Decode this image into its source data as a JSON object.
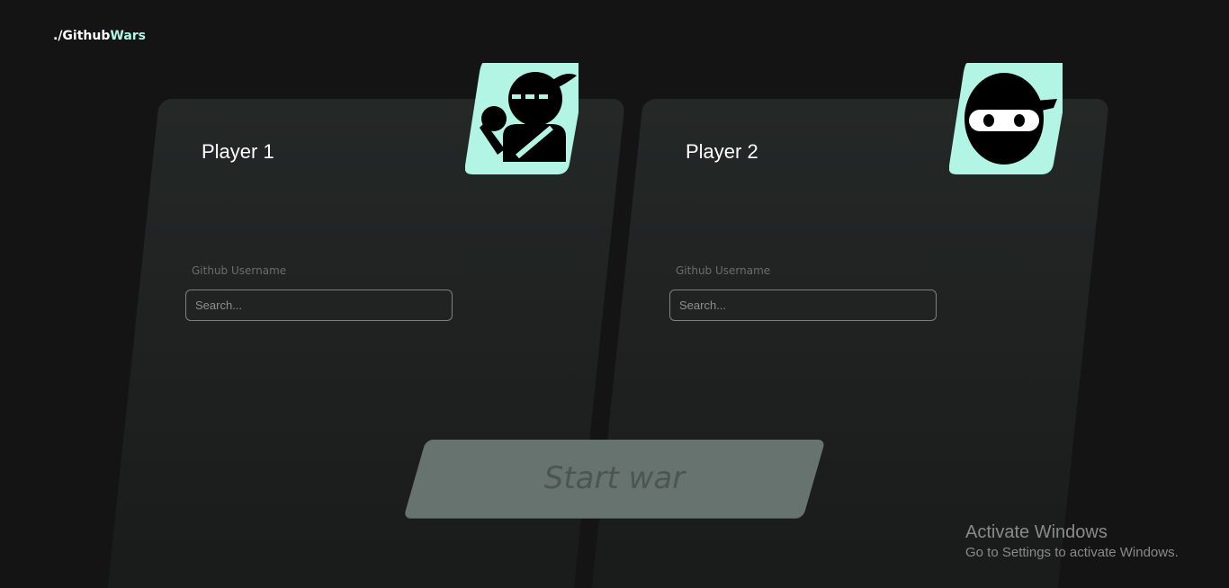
{
  "header": {
    "logo_prefix": "./Github",
    "logo_accent": "Wars"
  },
  "players": [
    {
      "title": "Player 1",
      "avatar_icon": "ninja-bust-icon",
      "field_label": "Github Username",
      "search_placeholder": "Search...",
      "search_value": ""
    },
    {
      "title": "Player 2",
      "avatar_icon": "ninja-head-icon",
      "field_label": "Github Username",
      "search_placeholder": "Search...",
      "search_value": ""
    }
  ],
  "actions": {
    "start_label": "Start war"
  },
  "watermark": {
    "title": "Activate Windows",
    "subtitle": "Go to Settings to activate Windows."
  },
  "colors": {
    "background": "#141414",
    "accent": "#b2f5e4",
    "card": "#232726",
    "button": "#66736e"
  }
}
